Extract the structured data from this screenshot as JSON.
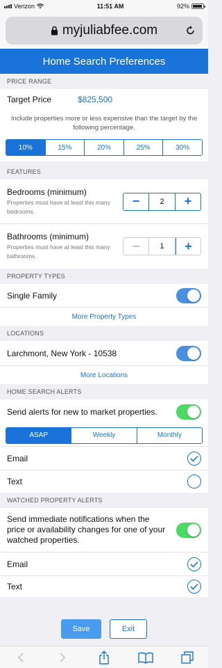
{
  "statusbar": {
    "carrier": "Verizon",
    "time": "11:51 AM",
    "battery": "92%",
    "battery_level": 0.92
  },
  "urlbar": {
    "domain": "myjuliabfee.com"
  },
  "header": {
    "title": "Home Search Preferences"
  },
  "price": {
    "section": "PRICE RANGE",
    "target_label": "Target Price",
    "target_value": "$825,500",
    "description": "Include properties more or less expensive than the target by the following percentage.",
    "options": [
      "10%",
      "15%",
      "20%",
      "25%",
      "30%"
    ],
    "selected": "10%"
  },
  "features": {
    "section": "FEATURES",
    "bedrooms": {
      "label": "Bedrooms (minimum)",
      "description": "Properties must have at least this many bedrooms.",
      "value": "2",
      "minus": "−",
      "plus": "+"
    },
    "bathrooms": {
      "label": "Bathrooms (minimum)",
      "description": "Properties must have at least this many bathrooms.",
      "value": "1",
      "minus": "−",
      "plus": "+"
    }
  },
  "property_types": {
    "section": "PROPERTY TYPES",
    "item": "Single Family",
    "item_on": true,
    "more": "More Property Types"
  },
  "locations": {
    "section": "LOCATIONS",
    "item": "Larchmont, New York - 10538",
    "item_on": true,
    "more": "More Locations"
  },
  "search_alerts": {
    "section": "HOME SEARCH ALERTS",
    "toggle_label": "Send alerts for new to market properties.",
    "toggle_on": true,
    "frequency": [
      "ASAP",
      "Weekly",
      "Monthly"
    ],
    "frequency_selected": "ASAP",
    "email_label": "Email",
    "email_checked": true,
    "text_label": "Text",
    "text_checked": false
  },
  "watched_alerts": {
    "section": "WATCHED PROPERTY ALERTS",
    "toggle_label": "Send immediate notifications when the price or availability changes for one of your watched properties.",
    "toggle_on": true,
    "email_label": "Email",
    "email_checked": true,
    "text_label": "Text",
    "text_checked": true
  },
  "footer": {
    "save": "Save",
    "exit": "Exit"
  },
  "colors": {
    "accent": "#1a73d9",
    "toggle_blue": "#4a90e2",
    "toggle_green": "#4cd964"
  }
}
